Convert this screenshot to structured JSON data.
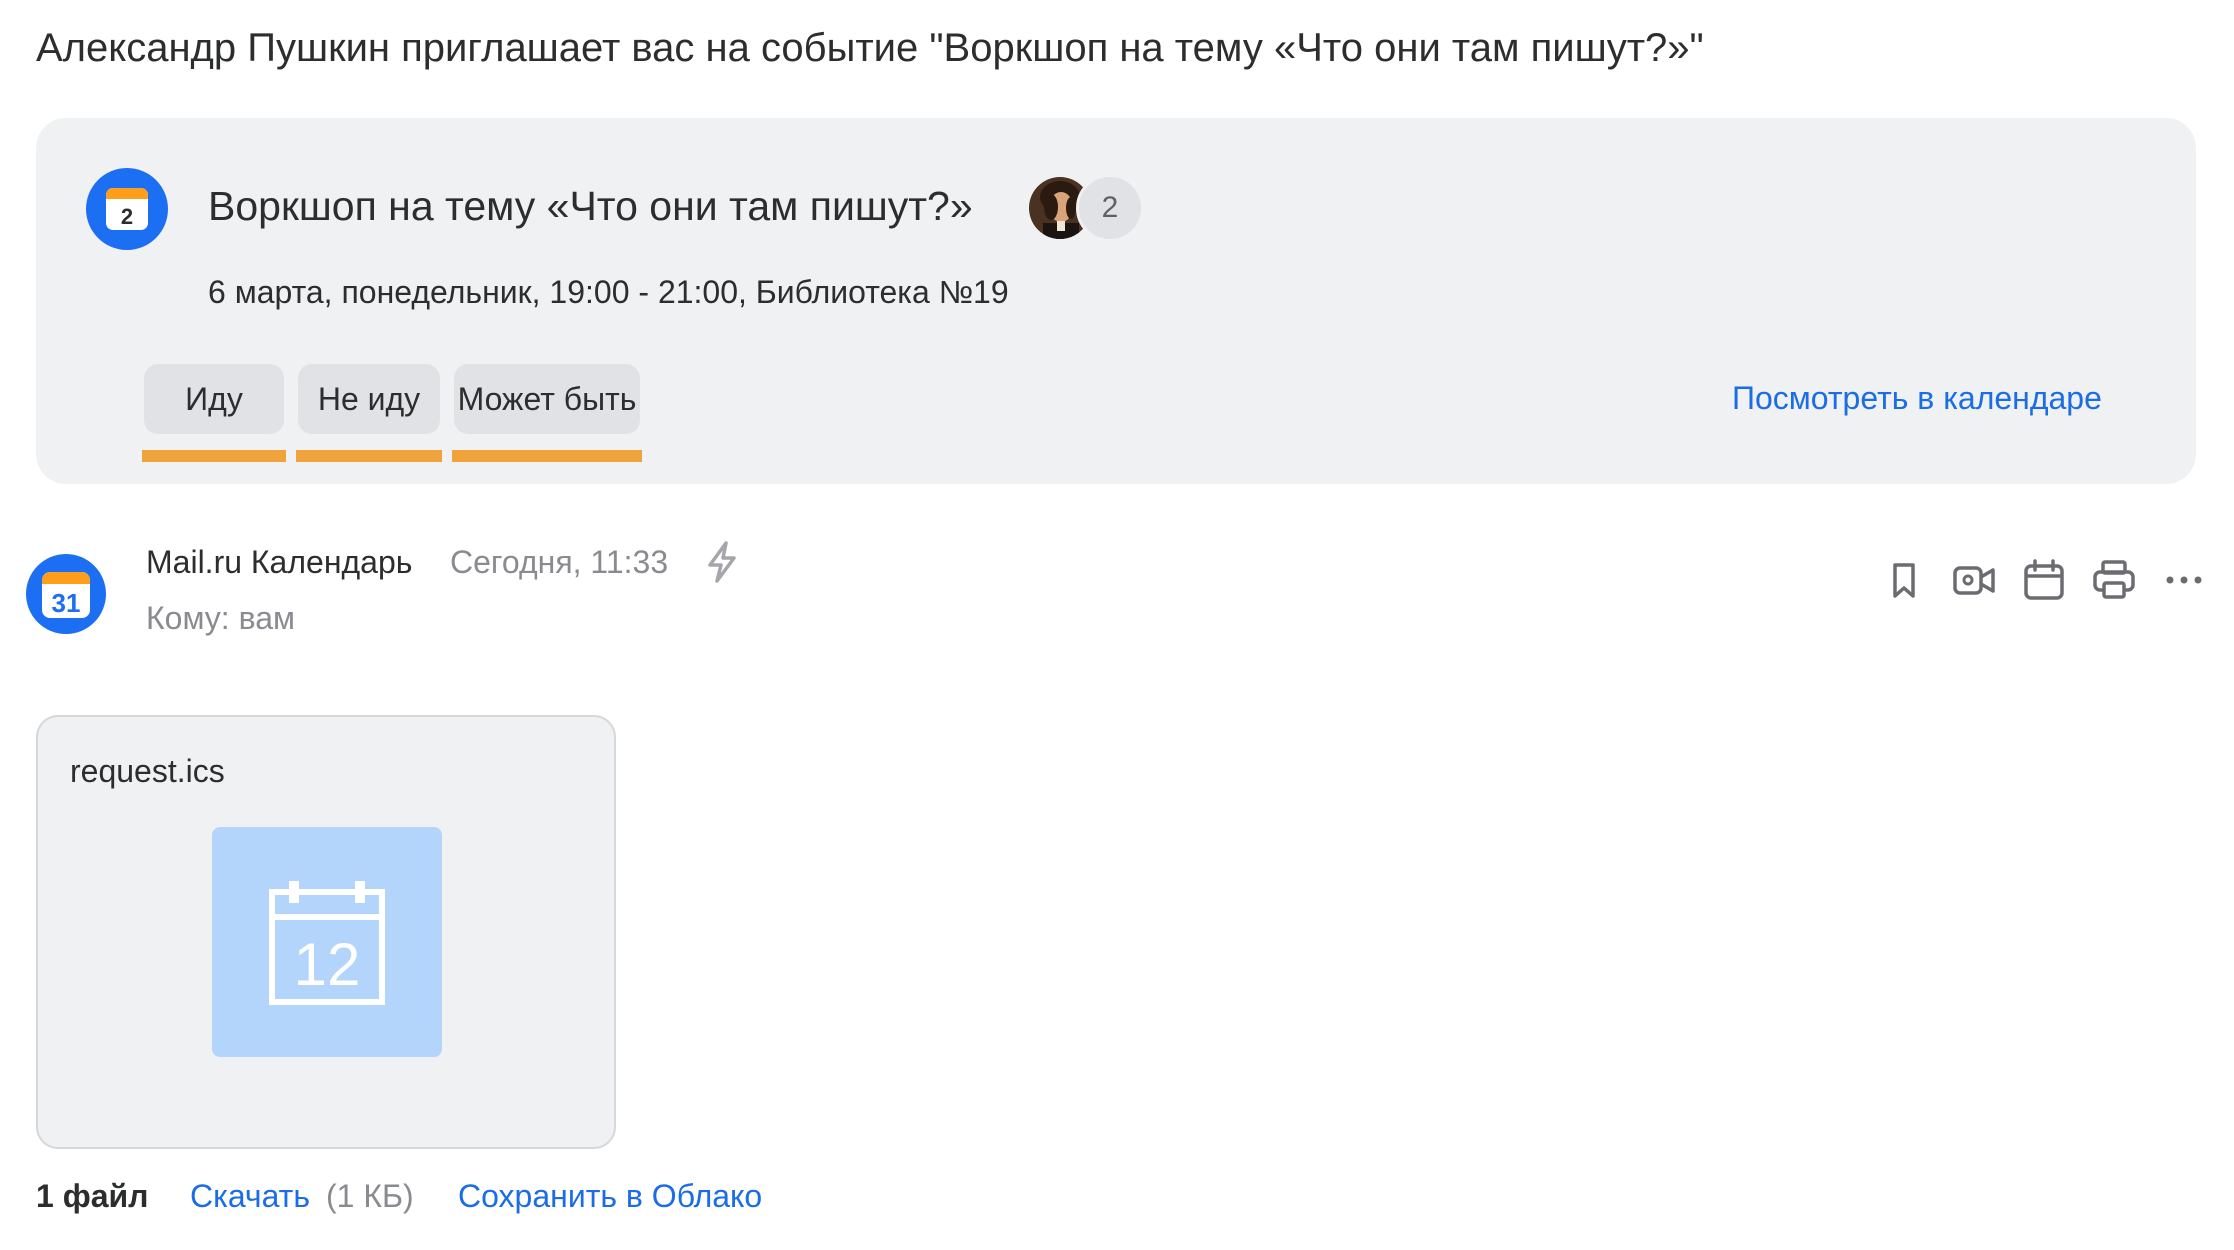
{
  "subject": "Александр Пушкин приглашает вас на событие \"Воркшоп на тему «Что они там пишут?»\"",
  "event": {
    "calendar_day": "2",
    "title": "Воркшоп на тему «Что они там пишут?»",
    "participants_extra": "2",
    "meta": "6 марта, понедельник, 19:00 - 21:00, Библиотека №19",
    "rsvp": {
      "yes_label": "Иду",
      "no_label": "Не иду",
      "maybe_label": "Может быть"
    },
    "view_in_calendar": "Посмотреть в календаре"
  },
  "message": {
    "sender_avatar_day": "31",
    "sender_name": "Mail.ru Календарь",
    "time": "Сегодня, 11:33",
    "recipient": "Кому: вам",
    "toolbar_icons": [
      "bookmark-icon",
      "video-call-icon",
      "calendar-icon",
      "print-icon",
      "more-icon"
    ]
  },
  "attachment": {
    "file_name": "request.ics",
    "thumb_day": "12"
  },
  "footer": {
    "files_count": "1 файл",
    "download_label": "Скачать",
    "download_size": "(1 КБ)",
    "save_cloud_label": "Сохранить в Облако"
  },
  "colors": {
    "accent_blue": "#1c6ef2",
    "link_blue": "#1a6de6",
    "highlight_orange": "#f0a33d",
    "card_bg": "#f0f1f3"
  }
}
